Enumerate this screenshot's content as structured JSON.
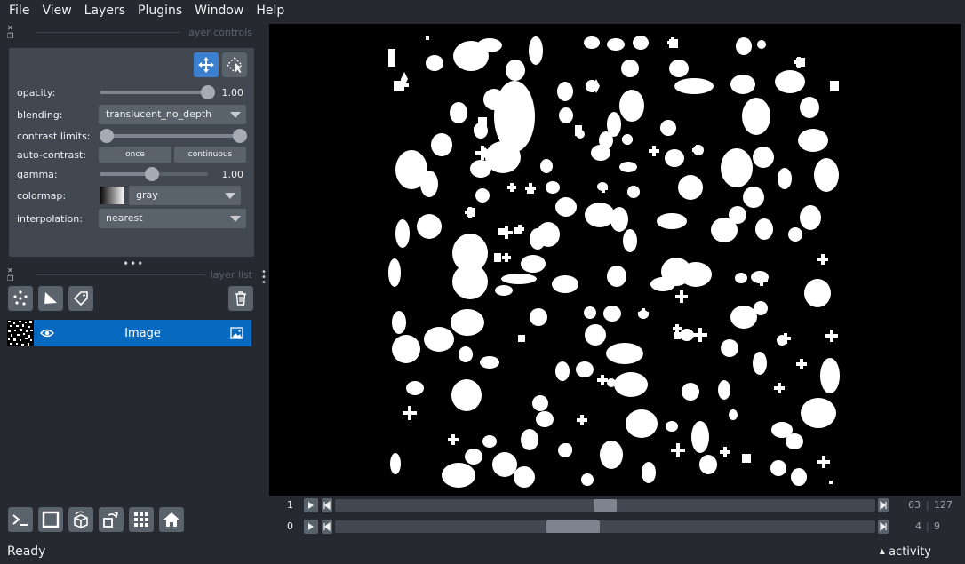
{
  "menu": [
    "File",
    "View",
    "Layers",
    "Plugins",
    "Window",
    "Help"
  ],
  "layer_controls": {
    "title": "layer controls",
    "opacity_label": "opacity:",
    "opacity_value": "1.00",
    "blending_label": "blending:",
    "blending_value": "translucent_no_depth",
    "contrast_label": "contrast limits:",
    "auto_contrast_label": "auto-contrast:",
    "once_label": "once",
    "continuous_label": "continuous",
    "gamma_label": "gamma:",
    "gamma_value": "1.00",
    "colormap_label": "colormap:",
    "colormap_value": "gray",
    "interpolation_label": "interpolation:",
    "interpolation_value": "nearest"
  },
  "layer_list": {
    "title": "layer list",
    "layers": [
      {
        "name": "Image",
        "visible": true,
        "selected": true
      }
    ]
  },
  "dims": [
    {
      "index": "1",
      "current": "63",
      "total": "127",
      "position_fraction": 0.5
    },
    {
      "index": "0",
      "current": "4",
      "total": "9",
      "position_fraction": 0.44
    }
  ],
  "status": {
    "text": "Ready",
    "activity_label": "activity"
  },
  "colors": {
    "selected_layer": "#0769c0",
    "background": "#262930",
    "panel": "#414851",
    "active_mode": "#3a7fd0"
  }
}
